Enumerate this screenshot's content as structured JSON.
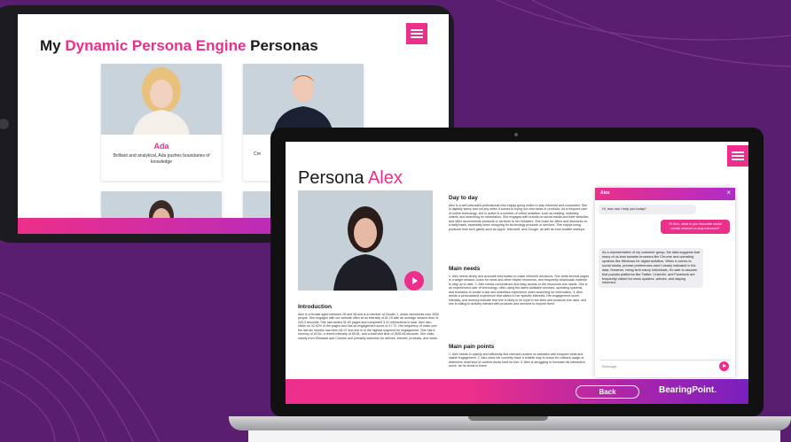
{
  "tablet": {
    "title_prefix": "My ",
    "title_highlight": "Dynamic Persona Engine",
    "title_suffix": " Personas",
    "personas": [
      {
        "name": "Ada",
        "description": "Brilliant and analytical, Ada pushes boundaries of knowledge"
      },
      {
        "name": "",
        "description": "Cre"
      }
    ]
  },
  "laptop": {
    "title_prefix": "Persona ",
    "title_highlight": "Alex",
    "introduction": {
      "heading": "Introduction",
      "body": "Alex is a female aged between 28 and 38 and is a member of Cluster 1, which represents over 3000 people. She engages with our website often at an intensity of 81.19 with an average session time of 343.3 seconds. She has visited 31.63 pages and completed 3.41 interactions in total. Alex also clicks on 32.92% of the pages and has an engagement score of 47.72. Her frequency of visits over the last six months has been 64.97 and she is in the highest segment for engagement. She has a recency of 42.54, a recent intensity of 85.81, and a total visit time of 2635.56 seconds. She visits mainly from Windows and Chrome and primarily searches for articles, themes, products, and news."
    },
    "day_to_day": {
      "heading": "Day to day",
      "body": "Alex is a well-educated professional who enjoys going online to stay informed and connected. She is digitally savvy and not shy when it comes to trying out new ideas or products. As a frequent user of online technology, she is active in a number of online activities, such as reading, watching videos, and searching for information. She engages with brands on social media and their websites and often recommends products or services to her followers. She looks for offers and discounts on a daily basis, especially when shopping for technology products or services. She enjoys using products from tech giants such as Apple, Microsoft, and Google, as well as from smaller startups."
    },
    "main_needs": {
      "heading": "Main needs",
      "body": "1. Alex needs timely and accurate information to make informed decisions. She visits several pages in a single session, looks for news and other helpful resources, and frequently downloads material to stay up to date. 2. Alex needs convenience and easy access to the resources she needs. She is an experienced user of technology, often using the latest available services, operating systems, and browsers to create a fast and seamless experience when searching for information. 3. Alex needs a personalized experience that caters to her specific interests. Her engagement score, intensity, and recency indicate that she is likely to be loyal to the sites and products she uses, and she is willing to actively interact with products and services to explore them."
    },
    "pain_points": {
      "heading": "Main pain points",
      "body": "1. Alex needs to quickly and efficiently find relevant content on websites with frequent visits and stable engagement. 2. Alex does not currently have a reliable way to check for rollback usage or determine what kind of content works best for him. 3. Alex is struggling to increase his interaction score, as he tends to leave"
    },
    "chat": {
      "name": "Alex",
      "close_icon": "close-icon",
      "greeting": "Hi, how can I help you today?",
      "user_message": "Hi Alex, what is you favourite social media channel to stay informed?",
      "bot_reply": "As a representative of my customer group, the data suggests that many of us lean towards browsers like Chrome and operating systems like Windows for digital activities. When it comes to social media, precise preferences aren't clearly indicated in the data. However, being tech-savvy individuals, it's safe to assume that popular platforms like Twitter, LinkedIn, and Facebook are frequently visited for news updates, articles, and staying informed.",
      "input_placeholder": "Message..."
    },
    "footer": {
      "back_label": "Back",
      "brand": "BearingPoint",
      "brand_dot": "."
    }
  },
  "colors": {
    "accent": "#ec2f8b",
    "background": "#5a1e70",
    "gradient_end": "#7a1fc0"
  }
}
